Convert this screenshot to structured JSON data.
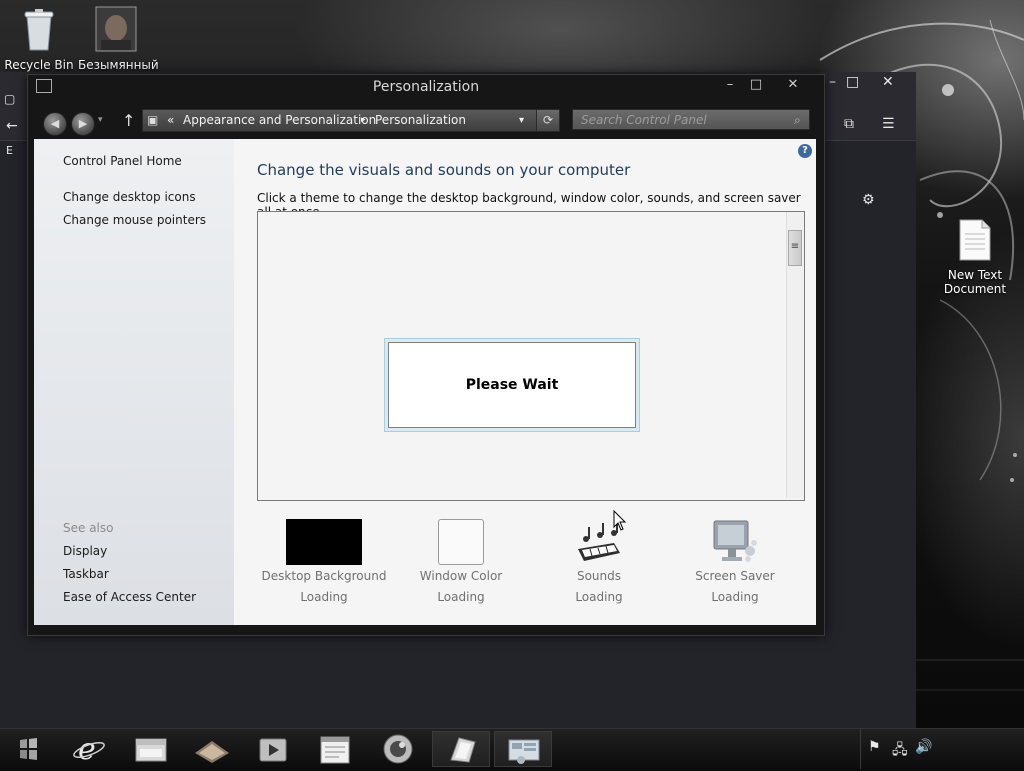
{
  "desktop": {
    "icons": [
      {
        "label": "Recycle Bin",
        "icon": "recycle-bin-icon"
      },
      {
        "label": "Безымянный",
        "icon": "photo-file-icon"
      },
      {
        "label": "New Text Document",
        "icon": "text-document-icon"
      }
    ]
  },
  "window": {
    "title": "Personalization",
    "controls": {
      "minimize": "–",
      "maximize": "□",
      "close": "✕"
    },
    "address": {
      "prefix": "«",
      "crumbs": [
        "Appearance and Personalization",
        "Personalization"
      ],
      "separator": "▸",
      "dropdown": "▾"
    },
    "search": {
      "placeholder": "Search Control Panel"
    },
    "left_pane": {
      "home": "Control Panel Home",
      "links": [
        "Change desktop icons",
        "Change mouse pointers"
      ],
      "see_also_title": "See also",
      "see_also": [
        "Display",
        "Taskbar",
        "Ease of Access Center"
      ]
    },
    "main": {
      "heading": "Change the visuals and sounds on your computer",
      "subheading": "Click a theme to change the desktop background, window color, sounds, and screen saver all at once.",
      "wait_text": "Please Wait",
      "options": [
        {
          "label": "Desktop Background",
          "status": "Loading",
          "icon": "black-swatch-icon"
        },
        {
          "label": "Window Color",
          "status": "Loading",
          "icon": "color-swatch-icon"
        },
        {
          "label": "Sounds",
          "status": "Loading",
          "icon": "music-keyboard-icon"
        },
        {
          "label": "Screen Saver",
          "status": "Loading",
          "icon": "monitor-icon"
        }
      ]
    }
  },
  "background_window": {
    "controls": {
      "minimize": "–",
      "maximize": "□",
      "close": "✕"
    },
    "visible_letter": "E"
  },
  "taskbar": {
    "items": [
      "start-button",
      "internet-explorer",
      "file-explorer",
      "media-center",
      "media-player",
      "notepad-app",
      "steam-app",
      "paint-app",
      "control-panel"
    ],
    "active": "control-panel"
  }
}
